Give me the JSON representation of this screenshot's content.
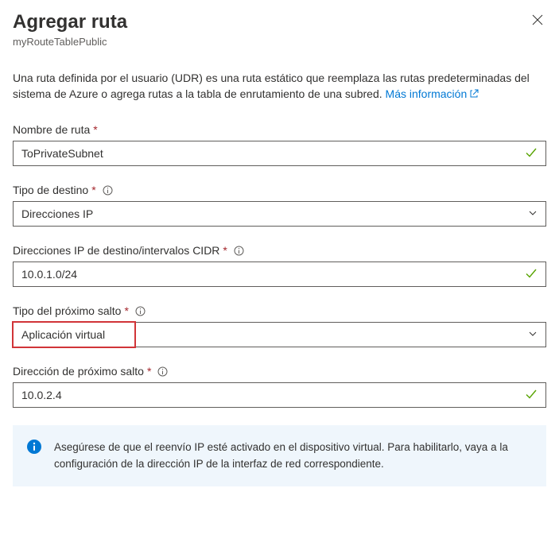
{
  "header": {
    "title": "Agregar ruta",
    "subtitle": "myRouteTablePublic"
  },
  "description": {
    "text": "Una ruta definida por el usuario (UDR) es una ruta estático que reemplaza las rutas predeterminadas del sistema de Azure o agrega rutas a la tabla de enrutamiento de una subred. ",
    "link": "Más información"
  },
  "fields": {
    "routeName": {
      "label": "Nombre de ruta",
      "value": "ToPrivateSubnet"
    },
    "destType": {
      "label": "Tipo de destino",
      "value": "Direcciones IP"
    },
    "destCidr": {
      "label": "Direcciones IP de destino/intervalos CIDR",
      "value": "10.0.1.0/24"
    },
    "nextHopType": {
      "label": "Tipo del próximo salto",
      "value": "Aplicación virtual"
    },
    "nextHopAddr": {
      "label": "Dirección de próximo salto",
      "value": "10.0.2.4"
    }
  },
  "infobox": {
    "text": "Asegúrese de que el reenvío IP esté activado en el dispositivo virtual. Para habilitarlo, vaya a la configuración de la dirección IP de la interfaz de red correspondiente."
  }
}
